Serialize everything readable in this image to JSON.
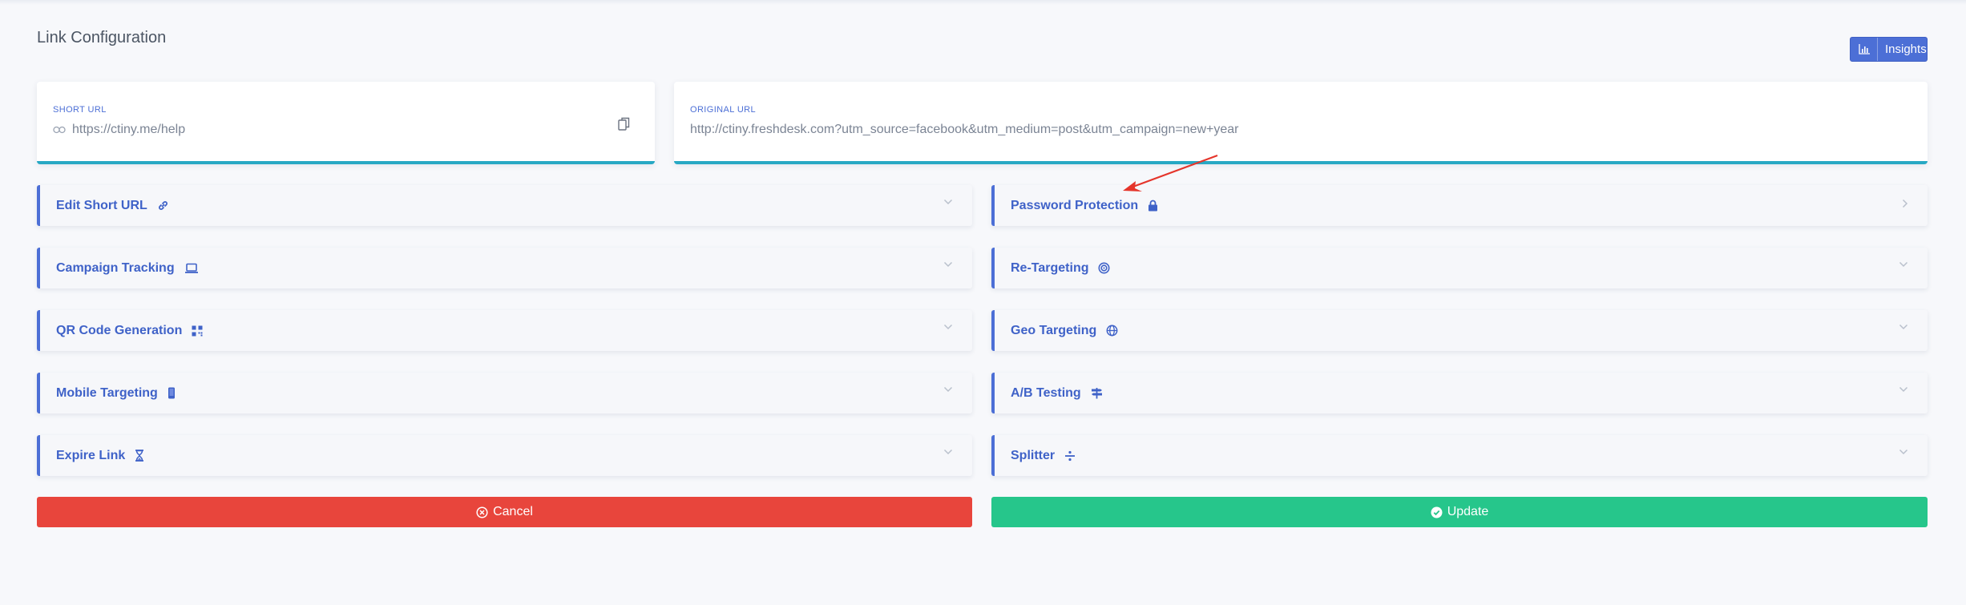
{
  "page": {
    "title": "Link Configuration",
    "insights_label": "Insights"
  },
  "short_url": {
    "label": "SHORT URL",
    "value": "https://ctiny.me/help"
  },
  "original_url": {
    "label": "ORIGINAL URL",
    "value": "http://ctiny.freshdesk.com?utm_source=facebook&utm_medium=post&utm_campaign=new+year"
  },
  "sections": {
    "left": [
      {
        "label": "Edit Short URL",
        "icon": "link-icon"
      },
      {
        "label": "Campaign Tracking",
        "icon": "laptop-icon"
      },
      {
        "label": "QR Code Generation",
        "icon": "qr-code-icon"
      },
      {
        "label": "Mobile Targeting",
        "icon": "mobile-icon"
      },
      {
        "label": "Expire Link",
        "icon": "hourglass-icon"
      }
    ],
    "right": [
      {
        "label": "Password Protection",
        "icon": "lock-icon"
      },
      {
        "label": "Re-Targeting",
        "icon": "target-icon"
      },
      {
        "label": "Geo Targeting",
        "icon": "globe-icon"
      },
      {
        "label": "A/B Testing",
        "icon": "signpost-icon"
      },
      {
        "label": "Splitter",
        "icon": "divide-icon"
      }
    ]
  },
  "actions": {
    "cancel_label": "Cancel",
    "update_label": "Update"
  },
  "colors": {
    "accent": "#4c6fd6",
    "cancel": "#e8453c",
    "update": "#26c68b",
    "card_border": "#27a8c4",
    "annotation_arrow": "#e5352b"
  }
}
